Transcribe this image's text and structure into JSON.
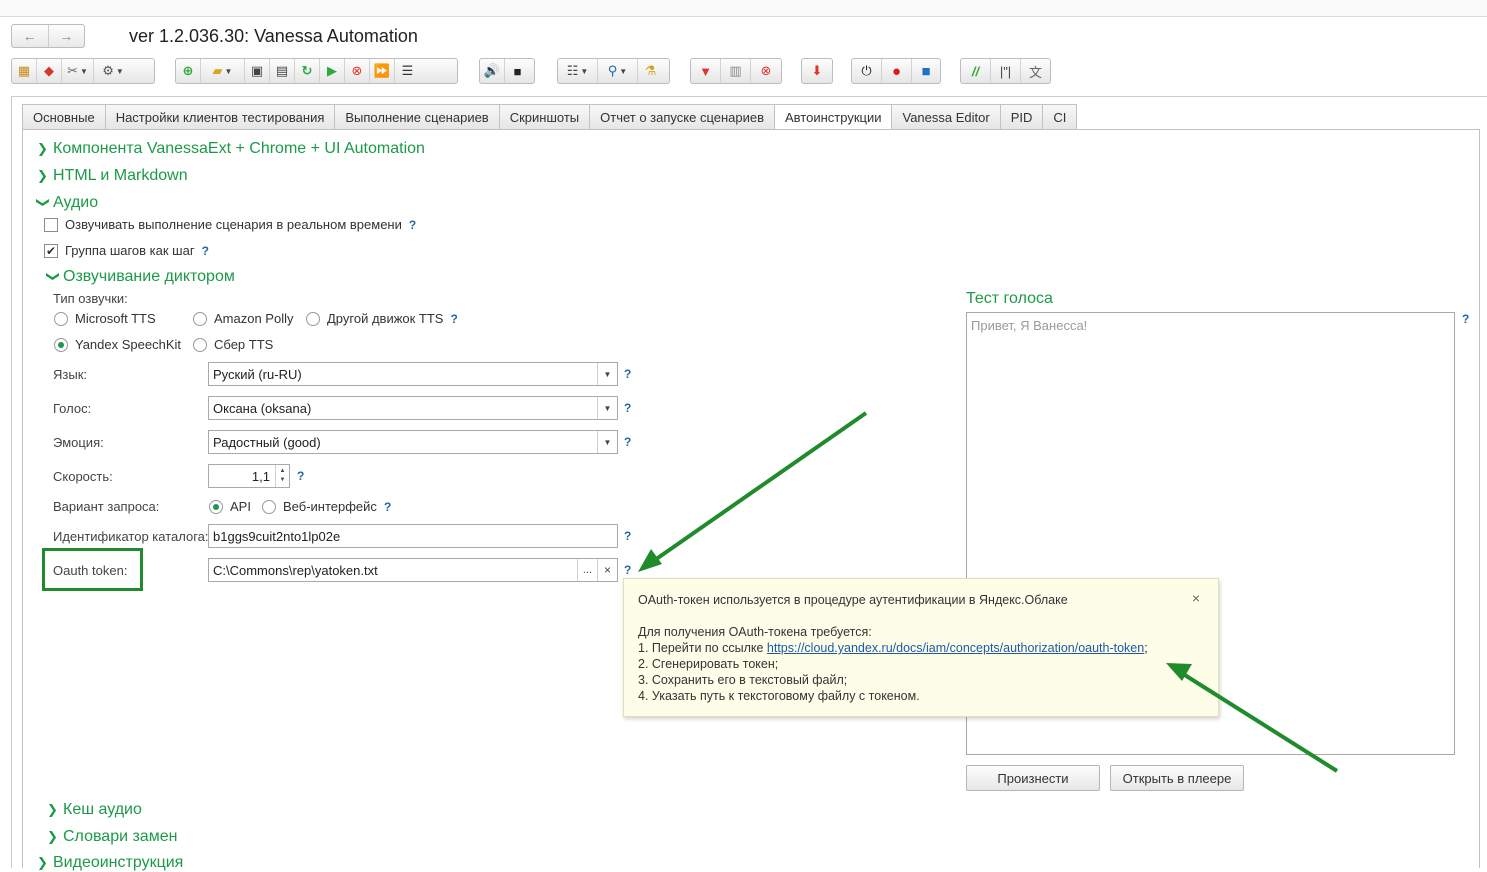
{
  "window": {
    "title": "ver 1.2.036.30: Vanessa Automation"
  },
  "nav": {
    "back": "←",
    "forward": "→"
  },
  "tabs": [
    "Основные",
    "Настройки клиентов тестирования",
    "Выполнение сценариев",
    "Скриншоты",
    "Отчет о запуске сценариев",
    "Автоинструкции",
    "Vanessa Editor",
    "PID",
    "CI"
  ],
  "active_tab": "Автоинструкции",
  "groups": {
    "component": "Компонента VanessaExt + Chrome + UI Automation",
    "html_md": "HTML и Markdown",
    "audio": "Аудио",
    "narrator": "Озвучивание диктором",
    "cache": "Кеш аудио",
    "dicts": "Словари замен",
    "video": "Видеоинструкция"
  },
  "audio": {
    "realtime_label": "Озвучивать выполнение сценария в реальном времени",
    "realtime_checked": false,
    "group_step_label": "Группа шагов как шаг",
    "group_step_checked": true,
    "help": "?"
  },
  "narrator": {
    "tts_type_label": "Тип озвучки:",
    "tts_options": [
      "Microsoft TTS",
      "Amazon Polly",
      "Другой движок TTS",
      "Yandex SpeechKit",
      "Сбер TTS"
    ],
    "tts_selected": "Yandex SpeechKit",
    "lang_label": "Язык:",
    "lang_value": "Руский (ru-RU)",
    "voice_label": "Голос:",
    "voice_value": "Оксана (oksana)",
    "emotion_label": "Эмоция:",
    "emotion_value": "Радостный (good)",
    "speed_label": "Скорость:",
    "speed_value": "1,1",
    "request_label": "Вариант запроса:",
    "request_options": [
      "API",
      "Веб-интерфейс"
    ],
    "request_selected": "API",
    "catalog_label": "Идентификатор каталога:",
    "catalog_value": "b1ggs9cuit2nto1lp02e",
    "oauth_label": "Oauth token:",
    "oauth_value": "C:\\Commons\\rep\\yatoken.txt",
    "browse": "...",
    "clear": "×"
  },
  "voice_test": {
    "label": "Тест голоса",
    "text": "Привет, Я Ванесса!",
    "speak_button": "Произнести",
    "open_player_button": "Открыть в плеере"
  },
  "tooltip": {
    "line1": "OAuth-токен используется в процедуре аутентификации в Яндекс.Облаке",
    "line2": "Для получения OAuth-токена требуется:",
    "line3_prefix": "1. Перейти по ссылке ",
    "line3_link": "https://cloud.yandex.ru/docs/iam/concepts/authorization/oauth-token",
    "line3_suffix": ";",
    "line4": "2. Сгенерировать токен;",
    "line5": "3. Сохранить его в текстовый файл;",
    "line6": "4. Указать путь к текстоговому файлу с токеном.",
    "close": "×"
  },
  "colors": {
    "accent_green": "#1c9a48",
    "arrow_green": "#1f8b2c",
    "tooltip_bg": "#fefde8",
    "help_blue": "#2466a8"
  }
}
